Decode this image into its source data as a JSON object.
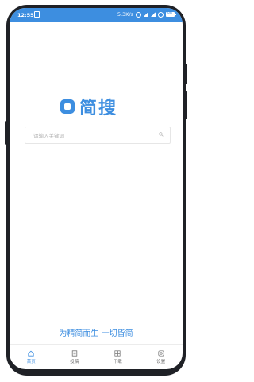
{
  "status_bar": {
    "time": "12:55",
    "network_speed": "5.3K/s",
    "battery": "80"
  },
  "logo": {
    "title": "简搜"
  },
  "search": {
    "placeholder": "请输入关键词"
  },
  "slogan": "为精简而生 一切皆简",
  "tabs": [
    {
      "label": "首页",
      "icon": "home-icon",
      "active": true
    },
    {
      "label": "投稿",
      "icon": "submit-icon",
      "active": false
    },
    {
      "label": "下载",
      "icon": "download-icon",
      "active": false
    },
    {
      "label": "设置",
      "icon": "settings-icon",
      "active": false
    }
  ],
  "colors": {
    "accent": "#3d8ee0",
    "frame": "#1f2126"
  }
}
